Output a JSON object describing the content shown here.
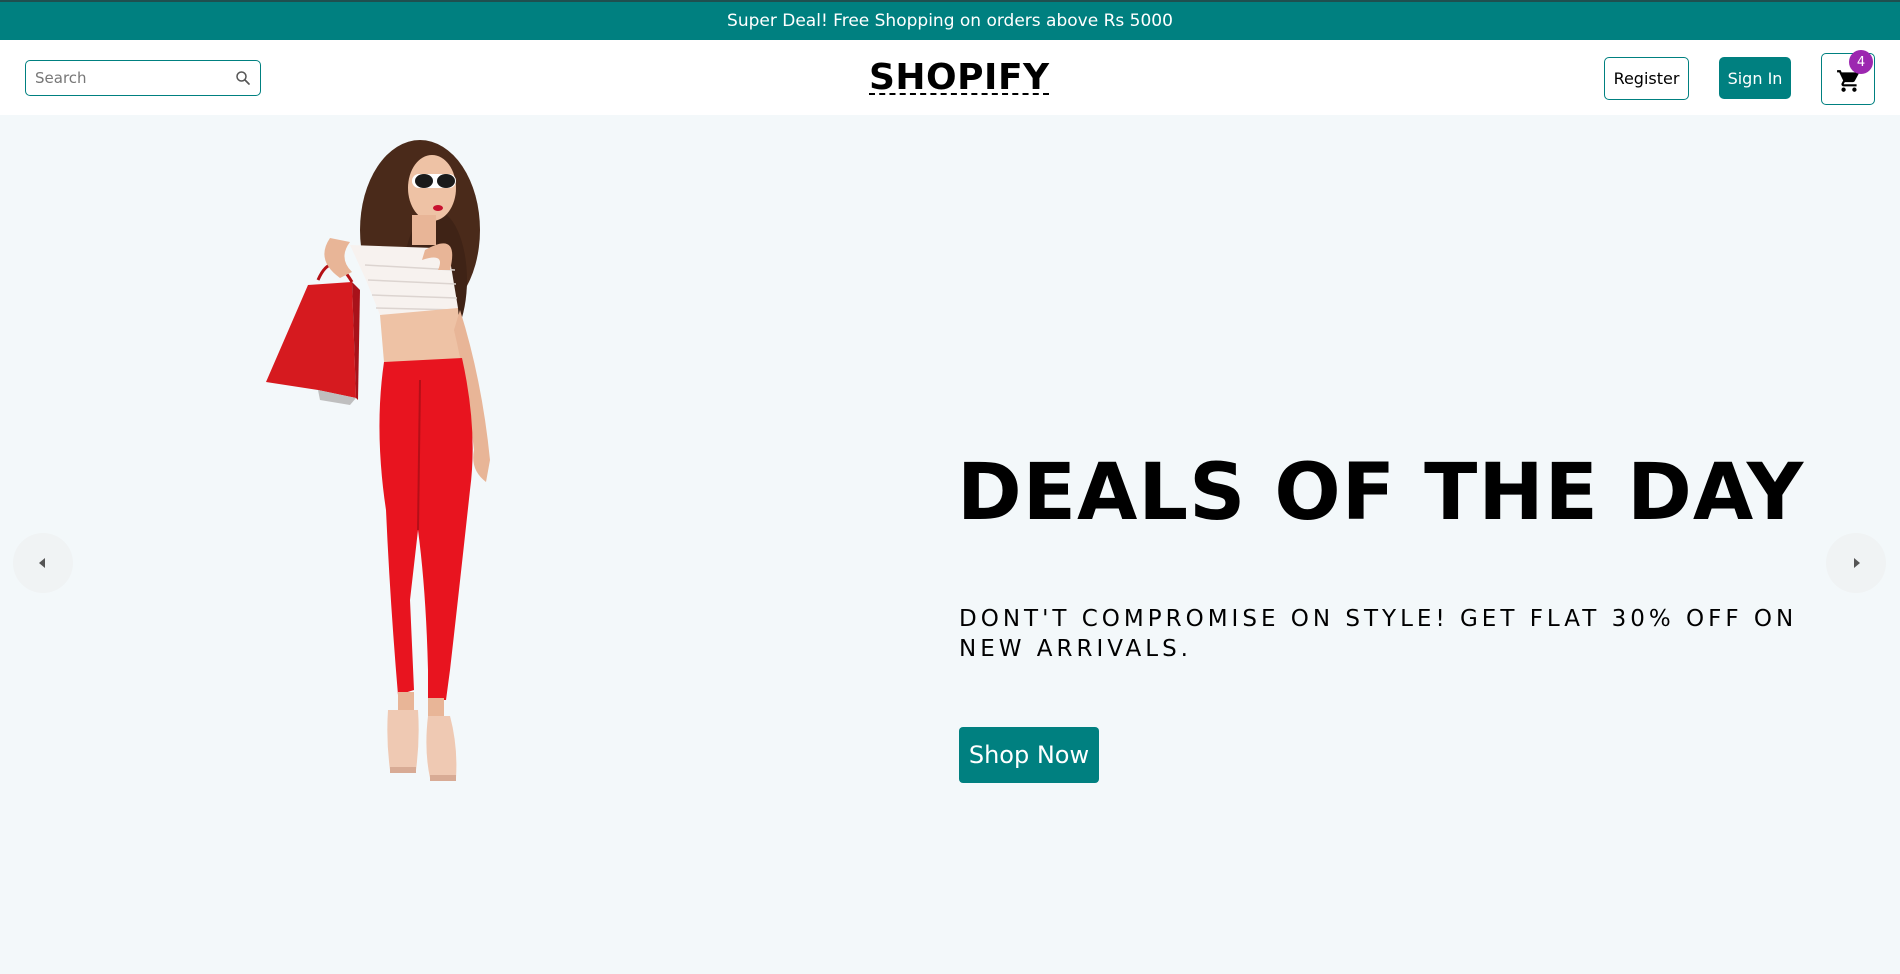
{
  "announcement": {
    "text": "Super Deal! Free Shopping on orders above Rs 5000"
  },
  "header": {
    "search": {
      "placeholder": "Search",
      "value": ""
    },
    "logo": "SHOPIFY",
    "register_label": "Register",
    "signin_label": "Sign In",
    "cart_count": "4"
  },
  "hero": {
    "title": "DEALS OF THE DAY",
    "subtitle": "DONT'T COMPROMISE ON STYLE! GET FLAT 30% OFF ON NEW ARRIVALS.",
    "cta_label": "Shop Now"
  },
  "colors": {
    "primary": "#008080",
    "badge": "#9c27b0",
    "hero_background": "#f3f8fa"
  },
  "icons": {
    "search": "search-icon",
    "cart": "cart-icon",
    "prev": "arrow-left-icon",
    "next": "arrow-right-icon"
  }
}
